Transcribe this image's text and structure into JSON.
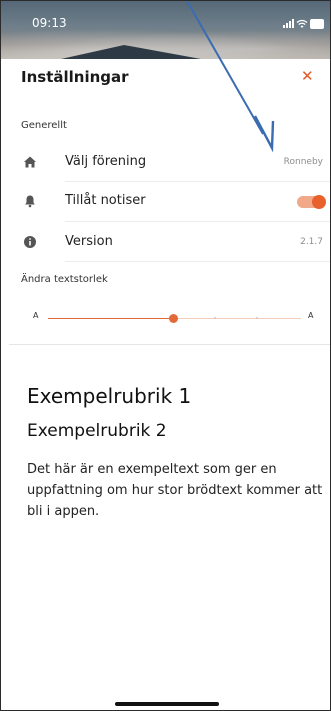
{
  "status": {
    "time": "09:13"
  },
  "sheet": {
    "title": "Inställningar",
    "close_symbol": "✕"
  },
  "general": {
    "section_label": "Generellt",
    "rows": [
      {
        "icon": "home-icon",
        "label": "Välj förening",
        "value": "Ronneby"
      },
      {
        "icon": "bell-icon",
        "label": "Tillåt notiser",
        "toggle_on": true
      },
      {
        "icon": "info-icon",
        "label": "Version",
        "value": "2.1.7"
      }
    ]
  },
  "text_size": {
    "section_label": "Ändra textstorlek",
    "small_label": "A",
    "large_label": "A",
    "level": 0.5
  },
  "preview": {
    "heading1": "Exempelrubrik 1",
    "heading2": "Exempelrubrik 2",
    "body": "Det här är en exempeltext som ger en uppfattning om hur stor brödtext kommer att bli i appen."
  },
  "colors": {
    "accent": "#E8602C",
    "arrow": "#3B6BB0"
  }
}
